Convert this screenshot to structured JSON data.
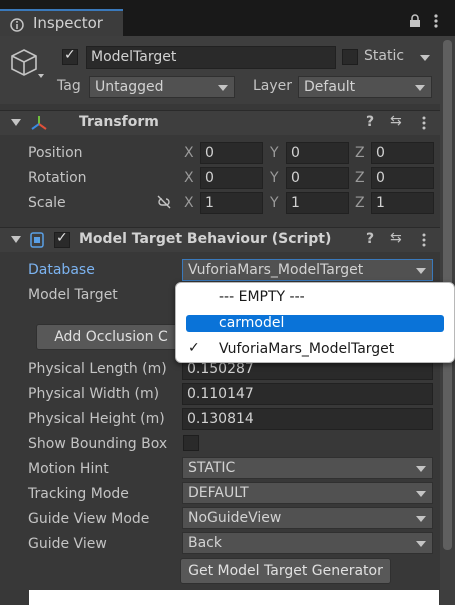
{
  "tab": {
    "title": "Inspector"
  },
  "gameobject": {
    "name": "ModelTarget",
    "static_label": "Static",
    "tag_label": "Tag",
    "tag_value": "Untagged",
    "layer_label": "Layer",
    "layer_value": "Default"
  },
  "transform": {
    "title": "Transform",
    "position_label": "Position",
    "rotation_label": "Rotation",
    "scale_label": "Scale",
    "axis_x": "X",
    "axis_y": "Y",
    "axis_z": "Z",
    "position": {
      "x": "0",
      "y": "0",
      "z": "0"
    },
    "rotation": {
      "x": "0",
      "y": "0",
      "z": "0"
    },
    "scale": {
      "x": "1",
      "y": "1",
      "z": "1"
    }
  },
  "behaviour": {
    "title": "Model Target Behaviour (Script)",
    "database_label": "Database",
    "database_value": "VuforiaMars_ModelTarget",
    "model_target_label": "Model Target",
    "add_occlusion_button": "Add Occlusion C",
    "physical_length_label": "Physical Length (m)",
    "physical_length_value": "0.150287",
    "physical_width_label": "Physical Width (m)",
    "physical_width_value": "0.110147",
    "physical_height_label": "Physical Height (m)",
    "physical_height_value": "0.130814",
    "bounding_box_label": "Show Bounding Box",
    "motion_hint_label": "Motion Hint",
    "motion_hint_value": "STATIC",
    "tracking_mode_label": "Tracking Mode",
    "tracking_mode_value": "DEFAULT",
    "guide_view_mode_label": "Guide View Mode",
    "guide_view_mode_value": "NoGuideView",
    "guide_view_label": "Guide View",
    "guide_view_value": "Back",
    "generator_button": "Get Model Target Generator"
  },
  "popup": {
    "items": [
      "--- EMPTY ---",
      "carmodel",
      "VuforiaMars_ModelTarget"
    ],
    "check": "✓"
  },
  "colors": {
    "accent": "#3a79bb",
    "selection": "#0a73d8",
    "link_blue": "#7cb3f0"
  }
}
